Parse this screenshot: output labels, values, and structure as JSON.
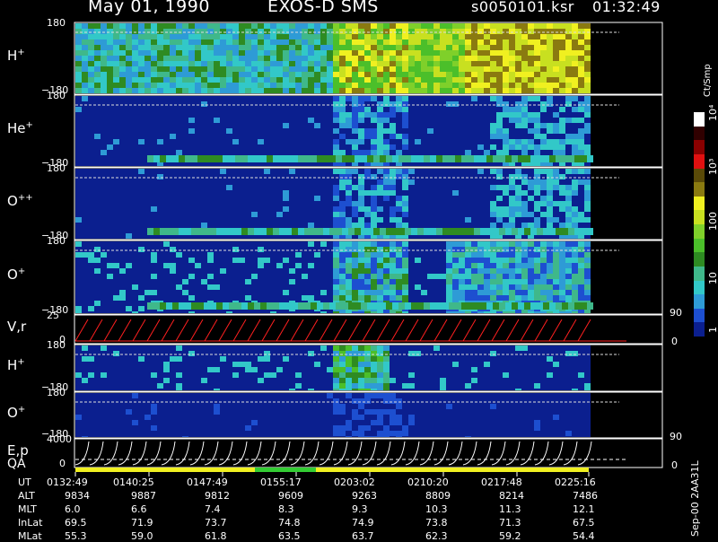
{
  "header": {
    "date": "May 01, 1990",
    "instrument": "EXOS-D SMS",
    "file": "s0050101.ksr",
    "time": "01:32:49"
  },
  "colorbar": {
    "units": "Ct/Smp",
    "ticks": [
      "1",
      "10",
      "100",
      "10³",
      "10⁴"
    ],
    "colors": [
      "#0b1f8f",
      "#1d4fd0",
      "#2e9bd6",
      "#32c8c8",
      "#3fb88a",
      "#2e8b22",
      "#4bbf2a",
      "#7fd02a",
      "#c8e020",
      "#f0f020",
      "#8a7a10",
      "#5a4a08",
      "#e01010",
      "#8a0000",
      "#300000",
      "#ffffff"
    ]
  },
  "panels": [
    {
      "label": "H",
      "sup": "+",
      "top": "180",
      "bottom": "−180"
    },
    {
      "label": "He",
      "sup": "+",
      "top": "180",
      "bottom": "−180"
    },
    {
      "label": "O",
      "sup": "++",
      "top": "180",
      "bottom": "−180"
    },
    {
      "label": "O",
      "sup": "+",
      "top": "180",
      "bottom": "−180"
    },
    {
      "label": "V,r",
      "sup": "",
      "top": "25",
      "bottom": "0",
      "right_top": "90",
      "right_bottom": "0"
    },
    {
      "label": "H",
      "sup": "+",
      "top": "180",
      "bottom": "−180"
    },
    {
      "label": "O",
      "sup": "+",
      "top": "180",
      "bottom": "−180"
    },
    {
      "label": "E,p",
      "sup": "",
      "top": "4000",
      "bottom": "0",
      "right_top": "90",
      "right_bottom": "0"
    }
  ],
  "qa_label": "QA",
  "time_table": {
    "row_labels": [
      "UT",
      "ALT",
      "MLT",
      "InLat",
      "MLat"
    ],
    "columns": [
      [
        "0132:49",
        "9834",
        "6.0",
        "69.5",
        "55.3"
      ],
      [
        "0140:25",
        "9887",
        "6.6",
        "71.9",
        "59.0"
      ],
      [
        "0147:49",
        "9812",
        "7.4",
        "73.7",
        "61.8"
      ],
      [
        "0155:17",
        "9609",
        "8.3",
        "74.8",
        "63.5"
      ],
      [
        "0203:02",
        "9263",
        "9.3",
        "74.9",
        "63.7"
      ],
      [
        "0210:20",
        "8809",
        "10.3",
        "73.8",
        "62.3"
      ],
      [
        "0217:48",
        "8214",
        "11.3",
        "71.3",
        "59.2"
      ],
      [
        "0225:16",
        "7486",
        "12.1",
        "67.5",
        "54.4"
      ]
    ]
  },
  "footer_code": "Sep-00 2AA31L",
  "chart_data": {
    "type": "heatmap",
    "title": "May 01, 1990   EXOS-D SMS",
    "x_ticks": [
      "0132:49",
      "0140:25",
      "0147:49",
      "0155:17",
      "0203:02",
      "0210:20",
      "0217:48",
      "0225:16"
    ],
    "y_range": [
      -180,
      180
    ],
    "color_scale": "log",
    "color_range": [
      1,
      10000
    ],
    "color_label": "Ct/Smp",
    "panels": [
      "H+",
      "He+",
      "O++",
      "O+",
      "V,r",
      "H+",
      "O+",
      "E,p"
    ]
  }
}
